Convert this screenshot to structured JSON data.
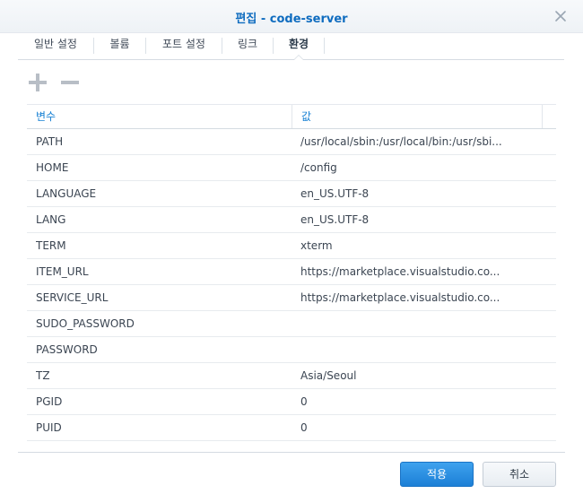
{
  "dialog": {
    "title": "편집 - code-server",
    "close_icon": "close-icon"
  },
  "tabs": [
    {
      "label": "일반 설정",
      "active": false
    },
    {
      "label": "볼륨",
      "active": false
    },
    {
      "label": "포트 설정",
      "active": false
    },
    {
      "label": "링크",
      "active": false
    },
    {
      "label": "환경",
      "active": true
    }
  ],
  "toolbar": {
    "add_icon": "plus-icon",
    "remove_icon": "minus-icon"
  },
  "table": {
    "columns": [
      "변수",
      "값"
    ],
    "rows": [
      {
        "name": "PATH",
        "value": "/usr/local/sbin:/usr/local/bin:/usr/sbi..."
      },
      {
        "name": "HOME",
        "value": "/config"
      },
      {
        "name": "LANGUAGE",
        "value": "en_US.UTF-8"
      },
      {
        "name": "LANG",
        "value": "en_US.UTF-8"
      },
      {
        "name": "TERM",
        "value": "xterm"
      },
      {
        "name": "ITEM_URL",
        "value": "https://marketplace.visualstudio.co..."
      },
      {
        "name": "SERVICE_URL",
        "value": "https://marketplace.visualstudio.co..."
      },
      {
        "name": "SUDO_PASSWORD",
        "value": ""
      },
      {
        "name": "PASSWORD",
        "value": ""
      },
      {
        "name": "TZ",
        "value": "Asia/Seoul"
      },
      {
        "name": "PGID",
        "value": "0"
      },
      {
        "name": "PUID",
        "value": "0"
      }
    ]
  },
  "footer": {
    "apply_label": "적용",
    "cancel_label": "취소"
  },
  "colors": {
    "accent": "#1a82d4",
    "title": "#0f6cbf"
  }
}
